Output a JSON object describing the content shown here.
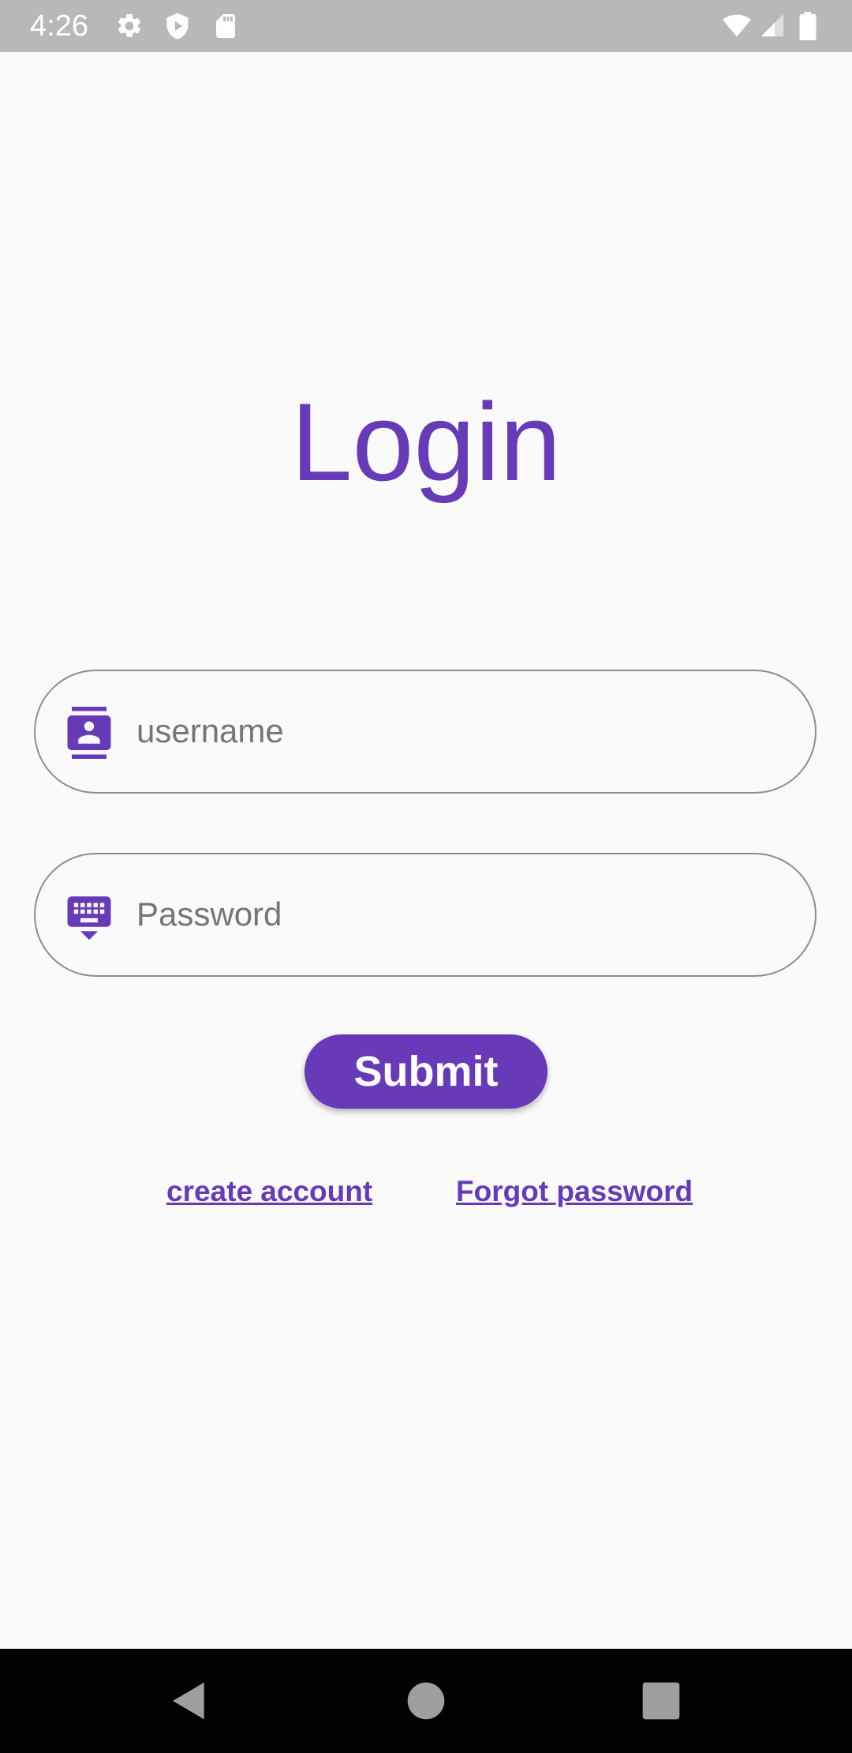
{
  "status_bar": {
    "time": "4:26",
    "icons_left": [
      "settings-icon",
      "shield-play-icon",
      "sd-card-icon"
    ],
    "icons_right": [
      "wifi-icon",
      "cell-signal-icon",
      "battery-icon"
    ],
    "background": "#b8b8b8"
  },
  "page": {
    "title": "Login",
    "accent_color": "#673ab7",
    "background": "#fafafa"
  },
  "form": {
    "username": {
      "icon": "contact-card-icon",
      "placeholder": "username",
      "value": ""
    },
    "password": {
      "icon": "keyboard-hide-icon",
      "placeholder": "Password",
      "value": ""
    },
    "submit_label": "Submit"
  },
  "links": {
    "create_account": "create account",
    "forgot_password": "Forgot password"
  },
  "nav_bar": {
    "buttons": [
      "back-icon",
      "home-icon",
      "recents-icon"
    ]
  }
}
